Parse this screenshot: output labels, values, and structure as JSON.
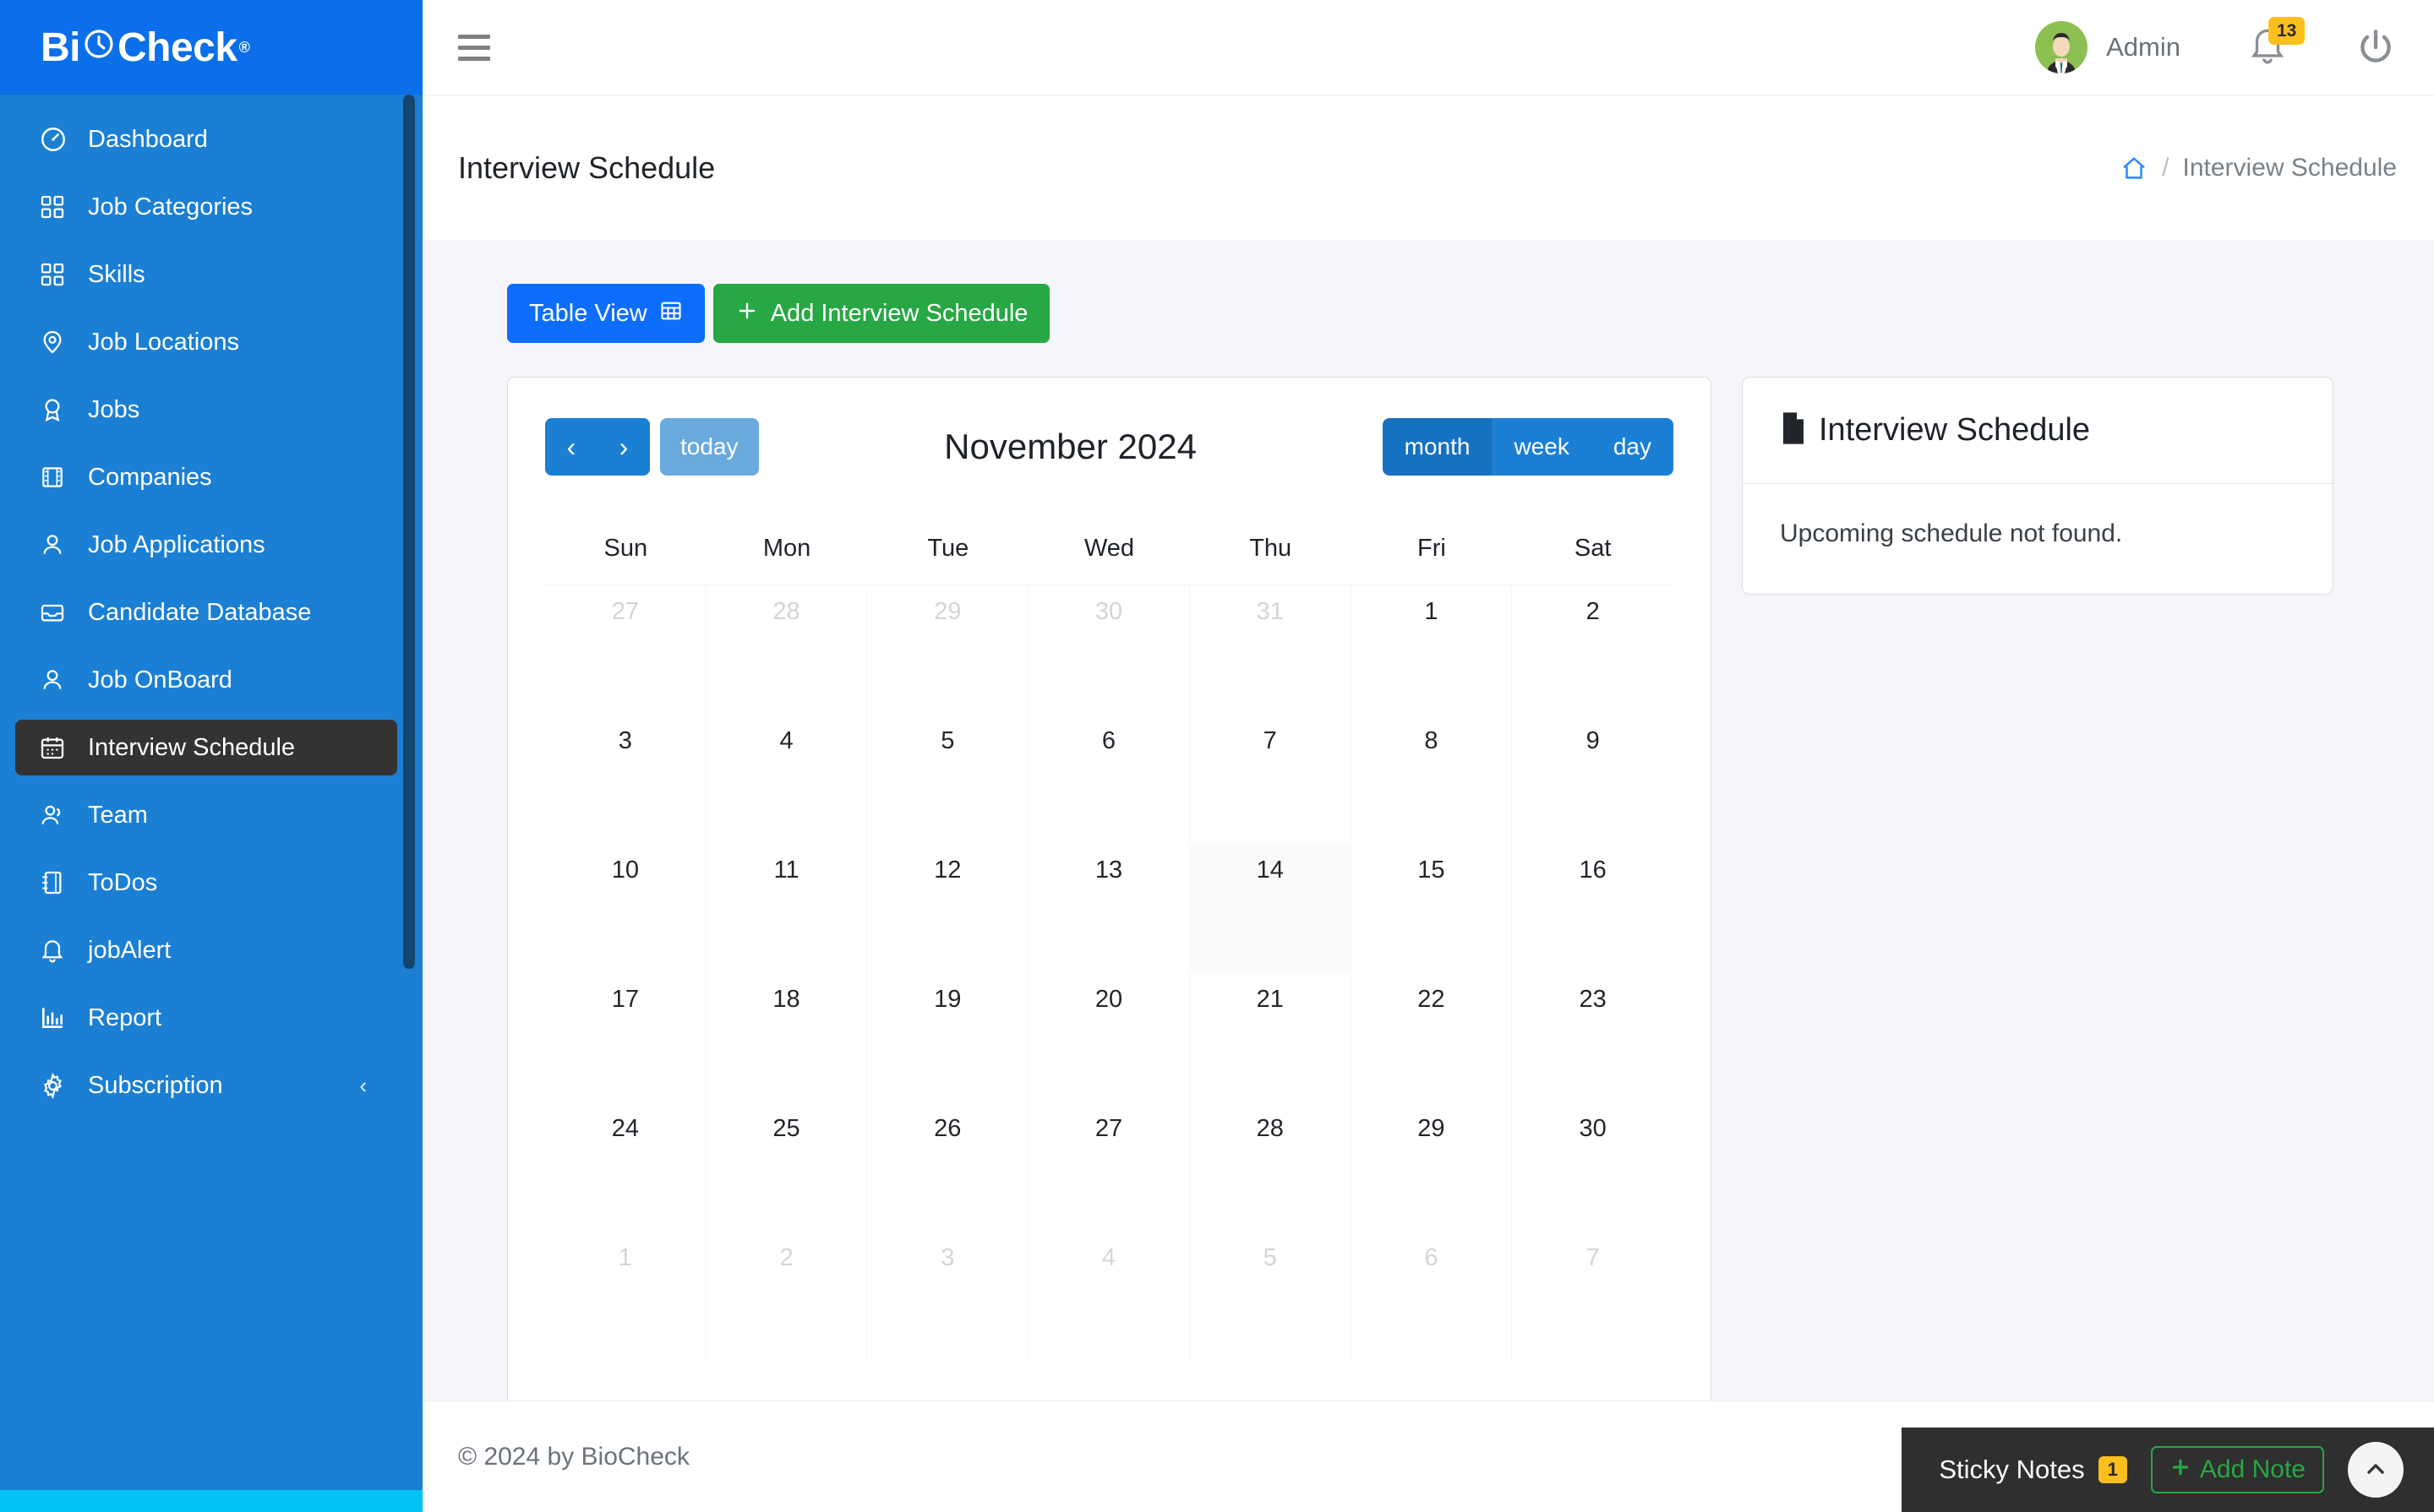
{
  "brand": {
    "part1": "Bi",
    "part2": "Check",
    "registered": "®"
  },
  "sidebar": {
    "items": [
      {
        "label": "Dashboard",
        "icon": "gauge-icon"
      },
      {
        "label": "Job Categories",
        "icon": "grid-icon"
      },
      {
        "label": "Skills",
        "icon": "grid-icon"
      },
      {
        "label": "Job Locations",
        "icon": "map-pin-icon"
      },
      {
        "label": "Jobs",
        "icon": "award-icon"
      },
      {
        "label": "Companies",
        "icon": "building-icon"
      },
      {
        "label": "Job Applications",
        "icon": "user-icon"
      },
      {
        "label": "Candidate Database",
        "icon": "inbox-icon"
      },
      {
        "label": "Job OnBoard",
        "icon": "user-icon"
      },
      {
        "label": "Interview Schedule",
        "icon": "calendar-icon",
        "active": true
      },
      {
        "label": "Team",
        "icon": "users-icon"
      },
      {
        "label": "ToDos",
        "icon": "notebook-icon"
      },
      {
        "label": "jobAlert",
        "icon": "bell-icon"
      },
      {
        "label": "Report",
        "icon": "bar-chart-icon"
      },
      {
        "label": "Subscription",
        "icon": "gear-icon",
        "caret": "‹"
      }
    ]
  },
  "topbar": {
    "menu_icon": "hamburger-icon",
    "user_name": "Admin",
    "notification_count": "13",
    "power_icon": "power-icon"
  },
  "pagehead": {
    "title": "Interview Schedule",
    "breadcrumb_home_icon": "home-icon",
    "breadcrumb_separator": "/",
    "breadcrumb_current": "Interview Schedule"
  },
  "toolbar": {
    "table_view_label": "Table View",
    "table_view_icon": "table-icon",
    "add_label": "Add Interview Schedule",
    "add_icon": "plus-icon"
  },
  "calendar": {
    "prev_label": "‹",
    "next_label": "›",
    "today_label": "today",
    "title": "November 2024",
    "views": [
      {
        "label": "month",
        "active": true
      },
      {
        "label": "week",
        "active": false
      },
      {
        "label": "day",
        "active": false
      }
    ],
    "day_headers": [
      "Sun",
      "Mon",
      "Tue",
      "Wed",
      "Thu",
      "Fri",
      "Sat"
    ],
    "weeks": [
      [
        {
          "n": "27",
          "other": true
        },
        {
          "n": "28",
          "other": true
        },
        {
          "n": "29",
          "other": true
        },
        {
          "n": "30",
          "other": true
        },
        {
          "n": "31",
          "other": true
        },
        {
          "n": "1"
        },
        {
          "n": "2"
        }
      ],
      [
        {
          "n": "3"
        },
        {
          "n": "4"
        },
        {
          "n": "5"
        },
        {
          "n": "6"
        },
        {
          "n": "7"
        },
        {
          "n": "8"
        },
        {
          "n": "9"
        }
      ],
      [
        {
          "n": "10"
        },
        {
          "n": "11"
        },
        {
          "n": "12"
        },
        {
          "n": "13"
        },
        {
          "n": "14",
          "today": true
        },
        {
          "n": "15"
        },
        {
          "n": "16"
        }
      ],
      [
        {
          "n": "17"
        },
        {
          "n": "18"
        },
        {
          "n": "19"
        },
        {
          "n": "20"
        },
        {
          "n": "21"
        },
        {
          "n": "22"
        },
        {
          "n": "23"
        }
      ],
      [
        {
          "n": "24"
        },
        {
          "n": "25"
        },
        {
          "n": "26"
        },
        {
          "n": "27"
        },
        {
          "n": "28"
        },
        {
          "n": "29"
        },
        {
          "n": "30"
        }
      ],
      [
        {
          "n": "1",
          "other": true
        },
        {
          "n": "2",
          "other": true
        },
        {
          "n": "3",
          "other": true
        },
        {
          "n": "4",
          "other": true
        },
        {
          "n": "5",
          "other": true
        },
        {
          "n": "6",
          "other": true
        },
        {
          "n": "7",
          "other": true
        }
      ]
    ]
  },
  "side_panel": {
    "icon": "file-icon",
    "title": "Interview Schedule",
    "empty_message": "Upcoming schedule not found."
  },
  "footer": {
    "text": "© 2024 by BioCheck"
  },
  "sticky_notes": {
    "label": "Sticky Notes",
    "count": "1",
    "add_label": "Add Note",
    "add_icon": "plus-icon",
    "scroll_top_icon": "chevron-up-icon"
  },
  "colors": {
    "sidebar_blue": "#1b7fd4",
    "brand_blue": "#0a6fe8",
    "accent_blue": "#0d6efd",
    "green": "#28a745",
    "amber": "#fcbf1e",
    "dark": "#2f2f2f",
    "cyan": "#00c2f3"
  }
}
